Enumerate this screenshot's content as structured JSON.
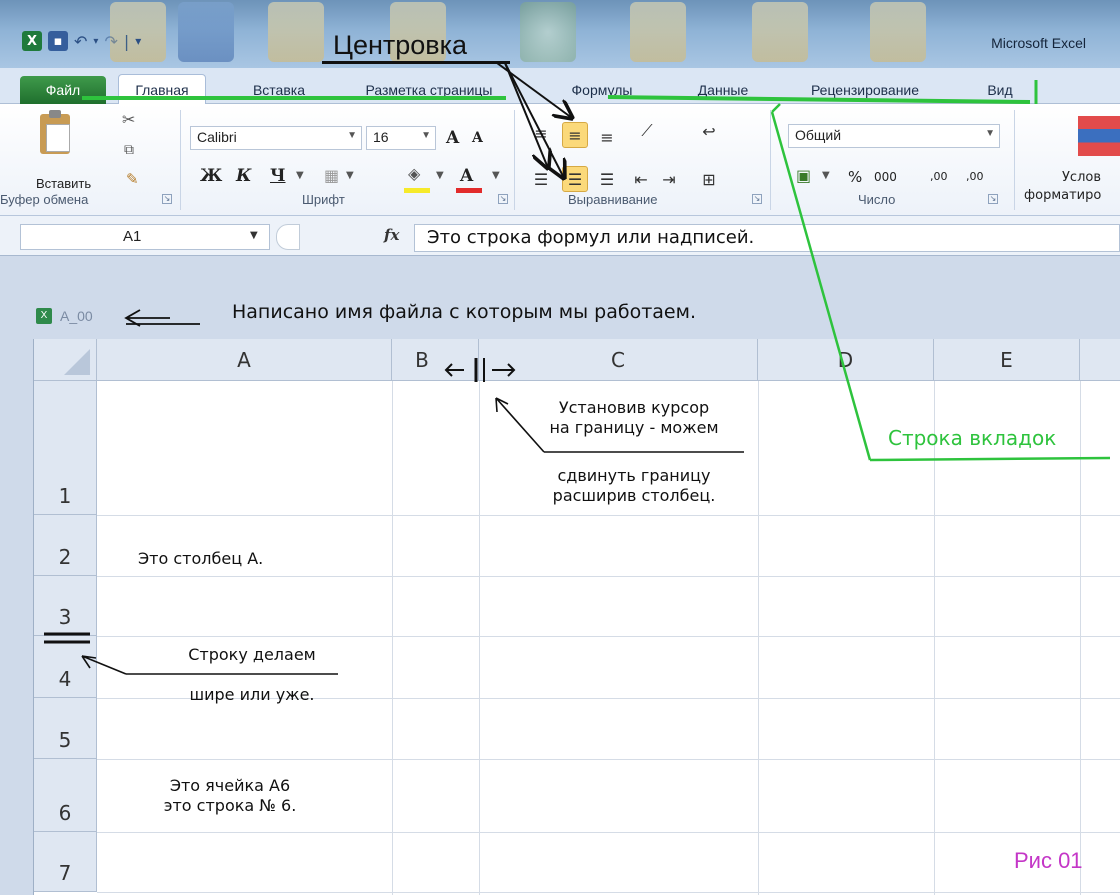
{
  "app": {
    "title": "Microsoft Excel",
    "quick_access": [
      "excel-logo",
      "save-icon",
      "undo-icon",
      "redo-icon",
      "customize-icon"
    ]
  },
  "annotations": {
    "centering": "Центровка",
    "filename_note": "Написано имя файла с которым мы работаем.",
    "column_resize_line1": "Установив курсор",
    "column_resize_line2": "на границу - можем",
    "column_resize_line3": "сдвинуть границу",
    "column_resize_line4": "расширив столбец.",
    "tab_row": "Строка вкладок",
    "figure": "Рис 01",
    "annotation_color": "#2ec33d",
    "figure_color": "#c436c7"
  },
  "tabs": [
    "Файл",
    "Главная",
    "Вставка",
    "Разметка страницы",
    "Формулы",
    "Данные",
    "Рецензирование",
    "Вид"
  ],
  "ribbon": {
    "clipboard": {
      "paste": "Вставить",
      "group": "Буфер обмена"
    },
    "font": {
      "name": "Calibri",
      "size": "16",
      "bold": "Ж",
      "italic": "К",
      "underline": "Ч",
      "grow": "A",
      "shrink": "A",
      "group": "Шрифт"
    },
    "alignment": {
      "group": "Выравнивание"
    },
    "number": {
      "format": "Общий",
      "percent": "%",
      "thousands": "000",
      "increase_decimal": ",00",
      "decrease_decimal": ",00",
      "group": "Число"
    },
    "styles": {
      "conditional_line1": "Услов",
      "conditional_line2": "форматиро"
    }
  },
  "formula_bar": {
    "name_box": "A1",
    "fx": "fx",
    "formula": "Это строка формул или надписей."
  },
  "workbook": {
    "file_name": "A_00"
  },
  "grid": {
    "columns": [
      "A",
      "B",
      "C",
      "D",
      "E"
    ],
    "rows": [
      "1",
      "2",
      "3",
      "4",
      "5",
      "6",
      "7"
    ],
    "cells": {
      "A2": "Это столбец  А.",
      "A4_line1": "Строку делаем",
      "A4_line2": "шире или уже.",
      "A6_line1": "Это ячейка А6",
      "A6_line2": "это строка № 6."
    }
  }
}
